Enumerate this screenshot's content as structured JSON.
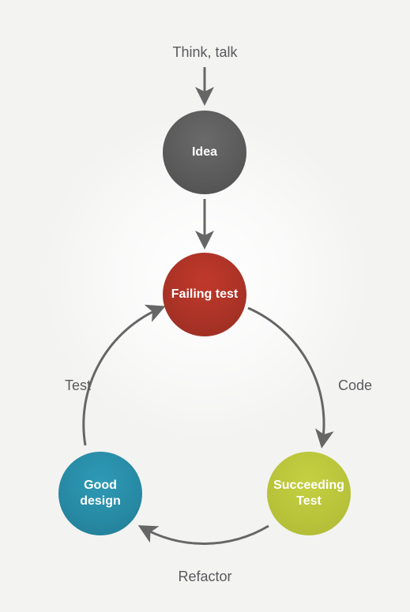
{
  "labels": {
    "top": "Think, talk",
    "right": "Code",
    "bottom": "Refactor",
    "left": "Test"
  },
  "nodes": {
    "idea": "Idea",
    "failing": "Failing test",
    "succeeding": "Succeeding Test",
    "good": "Good design"
  },
  "colors": {
    "idea": "#5b5b5b",
    "failing": "#a93226",
    "succeeding": "#b8c33a",
    "good": "#2789a3",
    "arrow": "#666666",
    "text": "#58595b",
    "background": "#f3f3f2"
  },
  "diagram": {
    "entry_label": "Think, talk",
    "entry_node": "Idea",
    "cycle": [
      {
        "node": "Failing test",
        "edge_to_next": "Code"
      },
      {
        "node": "Succeeding Test",
        "edge_to_next": "Refactor"
      },
      {
        "node": "Good design",
        "edge_to_next": "Test"
      }
    ]
  }
}
